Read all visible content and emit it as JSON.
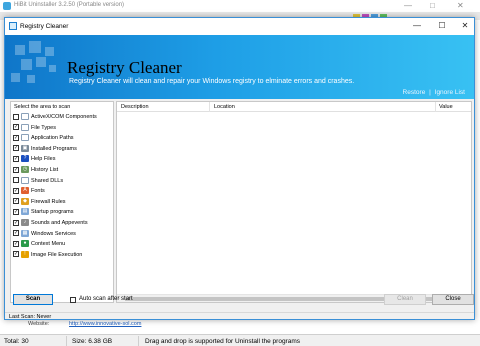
{
  "background_window": {
    "title": "HiBit Uninstaller 3.2.50 (Portable version)",
    "minimize": "—",
    "maximize": "□",
    "close": "✕",
    "website_label": "Website:",
    "website_url": "http://www.innovative-sol.com"
  },
  "status_bar": {
    "total": "Total: 30",
    "size": "Size: 6.38 GB",
    "hint": "Drag and drop is supported for Uninstall the programs"
  },
  "dialog": {
    "title": "Registry Cleaner",
    "minimize": "—",
    "maximize": "☐",
    "close": "✕",
    "banner": {
      "title": "Registry Cleaner",
      "description": "Registry Cleaner will clean and repair your Windows registry to elminate errors and crashes.",
      "restore": "Restore",
      "separator": "|",
      "ignore_list": "Ignore List",
      "accent": "#1e9ee6"
    },
    "left_panel": {
      "header": "Select the area to scan",
      "items": [
        {
          "label": "ActiveX/COM Components",
          "checked": false,
          "icon": "component-icon",
          "glyph": "",
          "color": "#ffffff"
        },
        {
          "label": "File Types",
          "checked": true,
          "icon": "file-icon",
          "glyph": "",
          "color": "#ffffff"
        },
        {
          "label": "Application Paths",
          "checked": true,
          "icon": "window-icon",
          "glyph": "",
          "color": "#ffffff"
        },
        {
          "label": "Installed Programs",
          "checked": true,
          "icon": "box-icon",
          "glyph": "▣",
          "color": "#7a8a99"
        },
        {
          "label": "Help Files",
          "checked": true,
          "icon": "help-icon",
          "glyph": "?",
          "color": "#1a4fc0"
        },
        {
          "label": "History List",
          "checked": true,
          "icon": "history-icon",
          "glyph": "◷",
          "color": "#6c9a5e"
        },
        {
          "label": "Shared DLLs",
          "checked": false,
          "icon": "dll-icon",
          "glyph": "",
          "color": "#ffffff"
        },
        {
          "label": "Fonts",
          "checked": true,
          "icon": "font-icon",
          "glyph": "A",
          "color": "#e06030"
        },
        {
          "label": "Firewall Rules",
          "checked": true,
          "icon": "shield-icon",
          "glyph": "◆",
          "color": "#e0a020"
        },
        {
          "label": "Startup programs",
          "checked": true,
          "icon": "startup-icon",
          "glyph": "▤",
          "color": "#7fa7d6"
        },
        {
          "label": "Sounds and Appevents",
          "checked": true,
          "icon": "sound-icon",
          "glyph": "♪",
          "color": "#8a8a8a"
        },
        {
          "label": "Windows Services",
          "checked": true,
          "icon": "services-icon",
          "glyph": "▦",
          "color": "#7fa7d6"
        },
        {
          "label": "Context Menu",
          "checked": true,
          "icon": "globe-icon",
          "glyph": "●",
          "color": "#2a9a4a"
        },
        {
          "label": "Image File Execution",
          "checked": true,
          "icon": "warning-icon",
          "glyph": "!",
          "color": "#e6a100"
        }
      ]
    },
    "results": {
      "columns": [
        "Description",
        "Location",
        "Value"
      ],
      "scroll_left": "‹",
      "scroll_right": "›"
    },
    "buttons": {
      "scan": "Scan",
      "auto_scan": "Auto scan after start",
      "auto_scan_checked": false,
      "clean": "Clean",
      "close": "Close"
    },
    "status": {
      "last_scan": "Last Scan: Never"
    }
  }
}
